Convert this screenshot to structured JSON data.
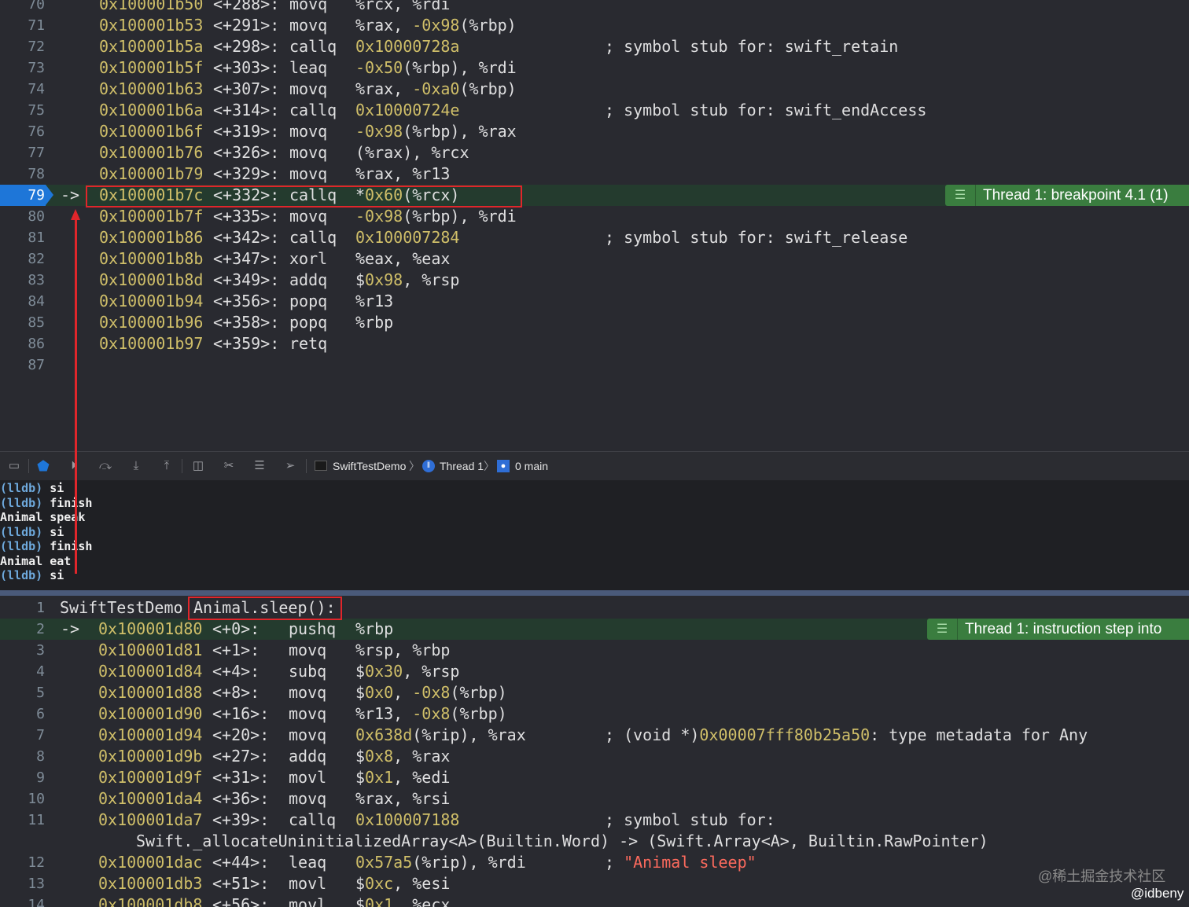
{
  "top_disassembly": {
    "rows": [
      {
        "line": "70",
        "addr": "0x100001b50",
        "off": "<+288>:",
        "mn": "movq",
        "ops": [
          [
            "op",
            "%rcx, %rdi"
          ]
        ],
        "comment": []
      },
      {
        "line": "71",
        "addr": "0x100001b53",
        "off": "<+291>:",
        "mn": "movq",
        "ops": [
          [
            "op",
            "%rax, "
          ],
          [
            "num",
            "-0x98"
          ],
          [
            "op",
            "(%rbp)"
          ]
        ],
        "comment": []
      },
      {
        "line": "72",
        "addr": "0x100001b5a",
        "off": "<+298>:",
        "mn": "callq",
        "ops": [
          [
            "num",
            "0x10000728a"
          ]
        ],
        "comment": [
          [
            "cm",
            "; symbol stub for: swift_retain"
          ]
        ]
      },
      {
        "line": "73",
        "addr": "0x100001b5f",
        "off": "<+303>:",
        "mn": "leaq",
        "ops": [
          [
            "num",
            "-0x50"
          ],
          [
            "op",
            "(%rbp), %rdi"
          ]
        ],
        "comment": []
      },
      {
        "line": "74",
        "addr": "0x100001b63",
        "off": "<+307>:",
        "mn": "movq",
        "ops": [
          [
            "op",
            "%rax, "
          ],
          [
            "num",
            "-0xa0"
          ],
          [
            "op",
            "(%rbp)"
          ]
        ],
        "comment": []
      },
      {
        "line": "75",
        "addr": "0x100001b6a",
        "off": "<+314>:",
        "mn": "callq",
        "ops": [
          [
            "num",
            "0x10000724e"
          ]
        ],
        "comment": [
          [
            "cm",
            "; symbol stub for: swift_endAccess"
          ]
        ]
      },
      {
        "line": "76",
        "addr": "0x100001b6f",
        "off": "<+319>:",
        "mn": "movq",
        "ops": [
          [
            "num",
            "-0x98"
          ],
          [
            "op",
            "(%rbp), %rax"
          ]
        ],
        "comment": []
      },
      {
        "line": "77",
        "addr": "0x100001b76",
        "off": "<+326>:",
        "mn": "movq",
        "ops": [
          [
            "op",
            "(%rax), %rcx"
          ]
        ],
        "comment": []
      },
      {
        "line": "78",
        "addr": "0x100001b79",
        "off": "<+329>:",
        "mn": "movq",
        "ops": [
          [
            "op",
            "%rax, %r13"
          ]
        ],
        "comment": []
      },
      {
        "line": "79",
        "addr": "0x100001b7c",
        "off": "<+332>:",
        "mn": "callq",
        "ops": [
          [
            "op",
            "*"
          ],
          [
            "num",
            "0x60"
          ],
          [
            "op",
            "(%rcx)"
          ]
        ],
        "comment": [],
        "current": true
      },
      {
        "line": "80",
        "addr": "0x100001b7f",
        "off": "<+335>:",
        "mn": "movq",
        "ops": [
          [
            "num",
            "-0x98"
          ],
          [
            "op",
            "(%rbp), %rdi"
          ]
        ],
        "comment": []
      },
      {
        "line": "81",
        "addr": "0x100001b86",
        "off": "<+342>:",
        "mn": "callq",
        "ops": [
          [
            "num",
            "0x100007284"
          ]
        ],
        "comment": [
          [
            "cm",
            "; symbol stub for: swift_release"
          ]
        ]
      },
      {
        "line": "82",
        "addr": "0x100001b8b",
        "off": "<+347>:",
        "mn": "xorl",
        "ops": [
          [
            "op",
            "%eax, %eax"
          ]
        ],
        "comment": []
      },
      {
        "line": "83",
        "addr": "0x100001b8d",
        "off": "<+349>:",
        "mn": "addq",
        "ops": [
          [
            "op",
            "$"
          ],
          [
            "num",
            "0x98"
          ],
          [
            "op",
            ", %rsp"
          ]
        ],
        "comment": []
      },
      {
        "line": "84",
        "addr": "0x100001b94",
        "off": "<+356>:",
        "mn": "popq",
        "ops": [
          [
            "op",
            "%r13"
          ]
        ],
        "comment": []
      },
      {
        "line": "85",
        "addr": "0x100001b96",
        "off": "<+358>:",
        "mn": "popq",
        "ops": [
          [
            "op",
            "%rbp"
          ]
        ],
        "comment": []
      },
      {
        "line": "86",
        "addr": "0x100001b97",
        "off": "<+359>:",
        "mn": "retq",
        "ops": [],
        "comment": []
      },
      {
        "line": "87",
        "addr": "",
        "off": "",
        "mn": "",
        "ops": [],
        "comment": []
      }
    ],
    "current_marker": "->",
    "status_text": "Thread 1: breakpoint 4.1 (1)"
  },
  "debug_bar": {
    "process": "SwiftTestDemo",
    "thread": "Thread 1",
    "frame": "0 main",
    "separator": "〉"
  },
  "console": {
    "lines": [
      {
        "prompt": "(lldb)",
        "text": " si"
      },
      {
        "prompt": "(lldb)",
        "text": " finish"
      },
      {
        "prompt": "",
        "text": "Animal speak"
      },
      {
        "prompt": "(lldb)",
        "text": " si"
      },
      {
        "prompt": "(lldb)",
        "text": " finish"
      },
      {
        "prompt": "",
        "text": "Animal eat"
      },
      {
        "prompt": "(lldb)",
        "text": " si"
      }
    ]
  },
  "bottom_disassembly": {
    "header": {
      "line": "1",
      "module": "SwiftTestDemo",
      "symbol": "Animal.sleep():"
    },
    "rows": [
      {
        "line": "2",
        "addr": "0x100001d80",
        "off": "<+0>:",
        "mn": "pushq",
        "ops": [
          [
            "op",
            "%rbp"
          ]
        ],
        "comment": [],
        "current": true
      },
      {
        "line": "3",
        "addr": "0x100001d81",
        "off": "<+1>:",
        "mn": "movq",
        "ops": [
          [
            "op",
            "%rsp, %rbp"
          ]
        ],
        "comment": []
      },
      {
        "line": "4",
        "addr": "0x100001d84",
        "off": "<+4>:",
        "mn": "subq",
        "ops": [
          [
            "op",
            "$"
          ],
          [
            "num",
            "0x30"
          ],
          [
            "op",
            ", %rsp"
          ]
        ],
        "comment": []
      },
      {
        "line": "5",
        "addr": "0x100001d88",
        "off": "<+8>:",
        "mn": "movq",
        "ops": [
          [
            "op",
            "$"
          ],
          [
            "num",
            "0x0"
          ],
          [
            "op",
            ", "
          ],
          [
            "num",
            "-0x8"
          ],
          [
            "op",
            "(%rbp)"
          ]
        ],
        "comment": []
      },
      {
        "line": "6",
        "addr": "0x100001d90",
        "off": "<+16>:",
        "mn": "movq",
        "ops": [
          [
            "op",
            "%r13, "
          ],
          [
            "num",
            "-0x8"
          ],
          [
            "op",
            "(%rbp)"
          ]
        ],
        "comment": []
      },
      {
        "line": "7",
        "addr": "0x100001d94",
        "off": "<+20>:",
        "mn": "movq",
        "ops": [
          [
            "num",
            "0x638d"
          ],
          [
            "op",
            "(%rip), %rax"
          ]
        ],
        "comment": [
          [
            "cm",
            "; (void *)"
          ],
          [
            "num",
            "0x00007fff80b25a50"
          ],
          [
            "cm",
            ": type metadata for Any"
          ]
        ]
      },
      {
        "line": "8",
        "addr": "0x100001d9b",
        "off": "<+27>:",
        "mn": "addq",
        "ops": [
          [
            "op",
            "$"
          ],
          [
            "num",
            "0x8"
          ],
          [
            "op",
            ", %rax"
          ]
        ],
        "comment": []
      },
      {
        "line": "9",
        "addr": "0x100001d9f",
        "off": "<+31>:",
        "mn": "movl",
        "ops": [
          [
            "op",
            "$"
          ],
          [
            "num",
            "0x1"
          ],
          [
            "op",
            ", %edi"
          ]
        ],
        "comment": []
      },
      {
        "line": "10",
        "addr": "0x100001da4",
        "off": "<+36>:",
        "mn": "movq",
        "ops": [
          [
            "op",
            "%rax, %rsi"
          ]
        ],
        "comment": []
      },
      {
        "line": "11",
        "addr": "0x100001da7",
        "off": "<+39>:",
        "mn": "callq",
        "ops": [
          [
            "num",
            "0x100007188"
          ]
        ],
        "comment": [
          [
            "cm",
            "; symbol stub for:"
          ]
        ]
      },
      {
        "line": "",
        "addr": "",
        "off": "",
        "mn": "",
        "ops": [],
        "comment": [],
        "wrap": "Swift._allocateUninitializedArray<A>(Builtin.Word) -> (Swift.Array<A>, Builtin.RawPointer)"
      },
      {
        "line": "12",
        "addr": "0x100001dac",
        "off": "<+44>:",
        "mn": "leaq",
        "ops": [
          [
            "num",
            "0x57a5"
          ],
          [
            "op",
            "(%rip), %rdi"
          ]
        ],
        "comment": [
          [
            "cm",
            "; "
          ],
          [
            "str",
            "\"Animal sleep\""
          ]
        ]
      },
      {
        "line": "13",
        "addr": "0x100001db3",
        "off": "<+51>:",
        "mn": "movl",
        "ops": [
          [
            "op",
            "$"
          ],
          [
            "num",
            "0xc"
          ],
          [
            "op",
            ", %esi"
          ]
        ],
        "comment": []
      },
      {
        "line": "14",
        "addr": "0x100001db8",
        "off": "<+56>:",
        "mn": "movl",
        "ops": [
          [
            "op",
            "$"
          ],
          [
            "num",
            "0x1"
          ],
          [
            "op",
            ", %ecx"
          ]
        ],
        "comment": []
      }
    ],
    "current_marker": "->",
    "status_text": "Thread 1: instruction step into"
  },
  "watermarks": {
    "site": "@稀土掘金技术社区",
    "author": "@idbeny"
  },
  "colors": {
    "background": "#292a30",
    "address": "#d0bf69",
    "current_line": "#243b2e",
    "breakpoint": "#1e76d8",
    "status_pill": "#3a7d3f",
    "annotation": "#e0262b",
    "string": "#fc6a5d",
    "prompt": "#6ea9dc"
  }
}
